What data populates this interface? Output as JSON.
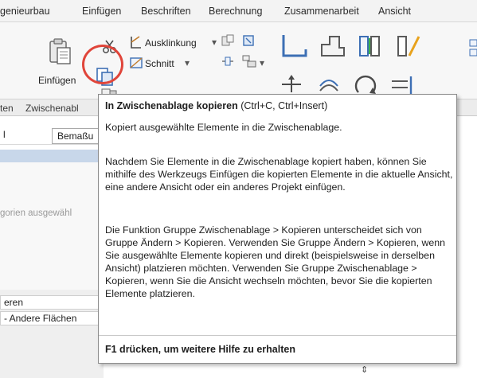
{
  "menubar": {
    "items": [
      "genieurbau",
      "Einfügen",
      "Beschriften",
      "Berechnung",
      "Zusammenarbeit",
      "Ansicht"
    ]
  },
  "ribbon": {
    "paste_label": "Einfügen",
    "ausklinkung_label": "Ausklinkung",
    "schnitt_label": "Schnitt",
    "group_labels": [
      "ten",
      "Zwischenabl"
    ]
  },
  "left_panel": {
    "type_selector": "Bemaßu",
    "left_cut": "l",
    "faded_text": "gorien ausgewähl",
    "row1": "eren",
    "row2": "- Andere Flächen"
  },
  "tooltip": {
    "title_bold": "In Zwischenablage kopieren",
    "title_shortcut": " (Ctrl+C, Ctrl+Insert)",
    "paragraph1": "Kopiert ausgewählte Elemente in die Zwischenablage.",
    "paragraph2": "Nachdem Sie Elemente in die Zwischenablage kopiert haben, können Sie mithilfe des Werkzeugs Einfügen die kopierten Elemente in die aktuelle Ansicht, eine andere Ansicht oder ein anderes Projekt einfügen.",
    "paragraph3": "Die Funktion Gruppe Zwischenablage > Kopieren unterscheidet sich von Gruppe Ändern > Kopieren. Verwenden Sie Gruppe Ändern > Kopieren, wenn Sie ausgewählte Elemente kopieren und direkt (beispielsweise in derselben Ansicht) platzieren möchten. Verwenden Sie Gruppe Zwischenablage > Kopieren, wenn Sie die Ansicht wechseln möchten, bevor Sie die kopierten Elemente platzieren.",
    "footer": "F1 drücken, um weitere Hilfe zu erhalten"
  },
  "colors": {
    "highlight_ring": "#e0453a",
    "tab_strip": "#c8d7ea"
  }
}
